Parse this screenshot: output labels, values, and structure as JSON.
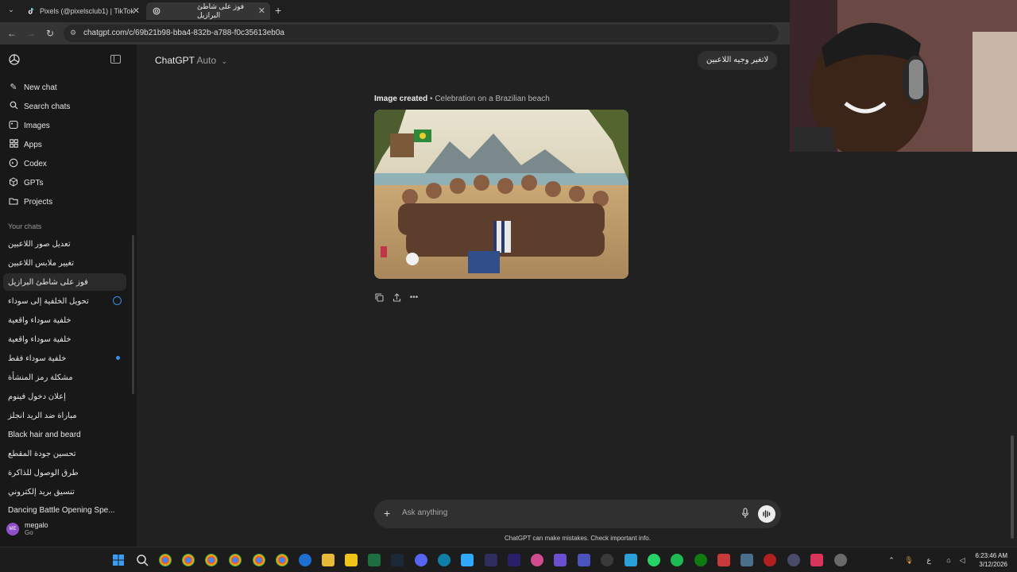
{
  "browser": {
    "tabs": [
      {
        "title": "Pixels (@pixelsclub1) | TikTok",
        "active": false
      },
      {
        "title": "فوز على شاطئ البرازيل",
        "active": true
      }
    ],
    "url": "chatgpt.com/c/69b21b98-bba4-832b-a788-f0c35613eb0a"
  },
  "sidebar": {
    "nav": [
      {
        "label": "New chat",
        "icon": "pencil-square-icon"
      },
      {
        "label": "Search chats",
        "icon": "search-icon"
      },
      {
        "label": "Images",
        "icon": "image-icon"
      },
      {
        "label": "Apps",
        "icon": "apps-grid-icon"
      },
      {
        "label": "Codex",
        "icon": "codex-icon"
      },
      {
        "label": "GPTs",
        "icon": "gpts-cube-icon"
      },
      {
        "label": "Projects",
        "icon": "folder-icon"
      }
    ],
    "section_label": "Your chats",
    "chats": [
      "تعديل صور اللاعبين",
      "تغيير ملابس اللاعبين",
      "فوز على شاطئ البرازيل",
      "تحويل الخلفية إلى سوداء",
      "خلفية سوداء واقعية",
      "خلفية سوداء واقعية",
      "خلفية سوداء فقط",
      "مشكلة رمز المنشأة",
      "إعلان دخول فينوم",
      "مباراة ضد الريد انجلز",
      "Black hair and beard",
      "تحسين جودة المقطع",
      "طرق الوصول للذاكرة",
      "تنسيق بريد إلكتروني",
      "Dancing Battle Opening Spe..."
    ],
    "user": {
      "name": "megalo",
      "plan": "Go",
      "initials": "ME"
    }
  },
  "main": {
    "model_name": "ChatGPT",
    "model_mode": "Auto",
    "user_message": "لاتغير وجيه اللاعبين",
    "image_caption_strong": "Image created",
    "image_caption_rest": "• Celebration on a Brazilian beach",
    "composer_placeholder": "Ask anything",
    "disclaimer": "ChatGPT can make mistakes. Check important info."
  },
  "taskbar": {
    "time": "6:23:46 AM",
    "date": "3/12/2026",
    "lang": "ع"
  }
}
